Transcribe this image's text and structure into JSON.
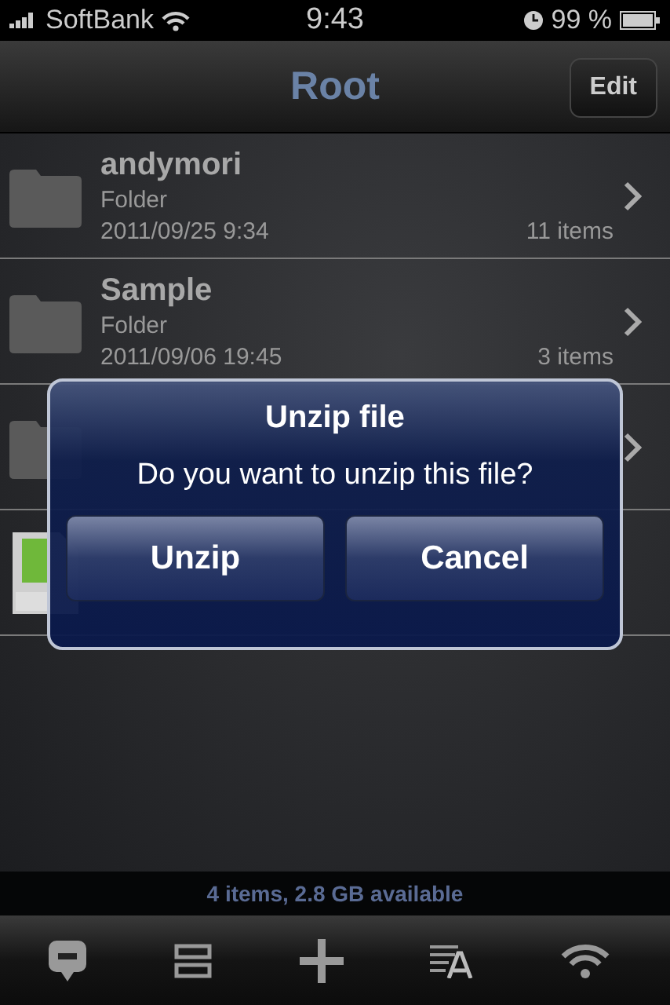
{
  "status_bar": {
    "carrier": "SoftBank",
    "time": "9:43",
    "battery": "99 %"
  },
  "nav_bar": {
    "title": "Root",
    "edit_button": "Edit"
  },
  "rows": [
    {
      "kind": "folder",
      "name": "andymori",
      "type": "Folder",
      "date": "2011/09/25 9:34",
      "count": "11 items"
    },
    {
      "kind": "folder",
      "name": "Sample",
      "type": "Folder",
      "date": "2011/09/06 19:45",
      "count": "3 items"
    },
    {
      "kind": "folder"
    },
    {
      "kind": "zip"
    }
  ],
  "dialog": {
    "title": "Unzip file",
    "message": "Do you want to unzip this file?",
    "buttons": [
      "Unzip",
      "Cancel"
    ]
  },
  "footer": "4 items, 2.8 GB available"
}
